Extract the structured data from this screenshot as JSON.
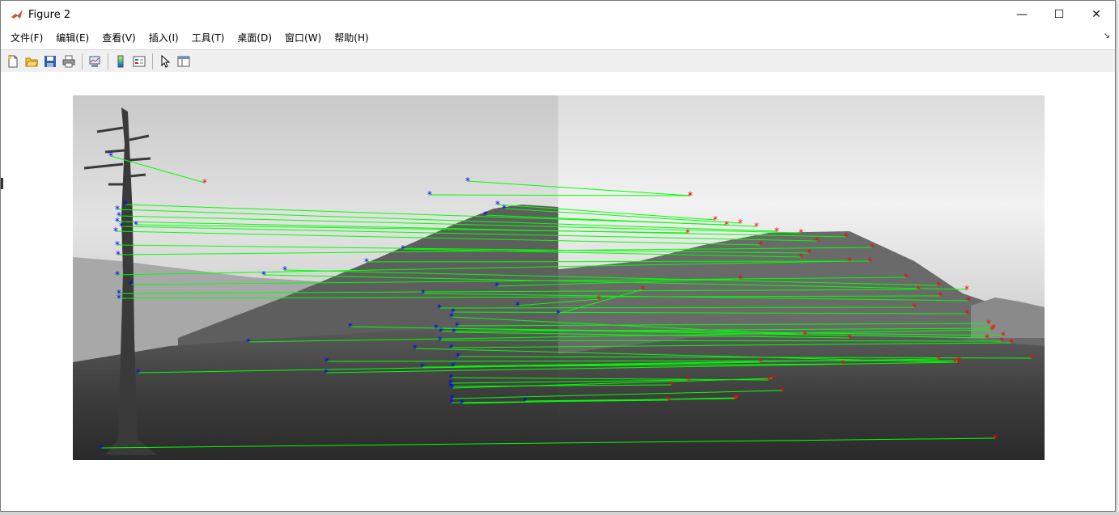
{
  "window": {
    "title": "Figure 2",
    "minimize_glyph": "—",
    "maximize_glyph": "☐",
    "close_glyph": "✕"
  },
  "menu": {
    "items": [
      "文件(F)",
      "编辑(E)",
      "查看(V)",
      "插入(I)",
      "工具(T)",
      "桌面(D)",
      "窗口(W)",
      "帮助(H)"
    ],
    "dock_glyph": "↘"
  },
  "toolbar": {
    "icons": [
      "new-figure-icon",
      "open-file-icon",
      "save-icon",
      "print-icon",
      "link-plot-icon",
      "colorbar-icon",
      "legend-icon",
      "pointer-icon",
      "property-editor-icon"
    ]
  },
  "figure": {
    "image_style": "grayscale mountain panorama, two side-by-side frames",
    "colors": {
      "match_line": "#00ff00",
      "left_marker": "#0000ff",
      "right_marker": "#ff0000"
    }
  }
}
